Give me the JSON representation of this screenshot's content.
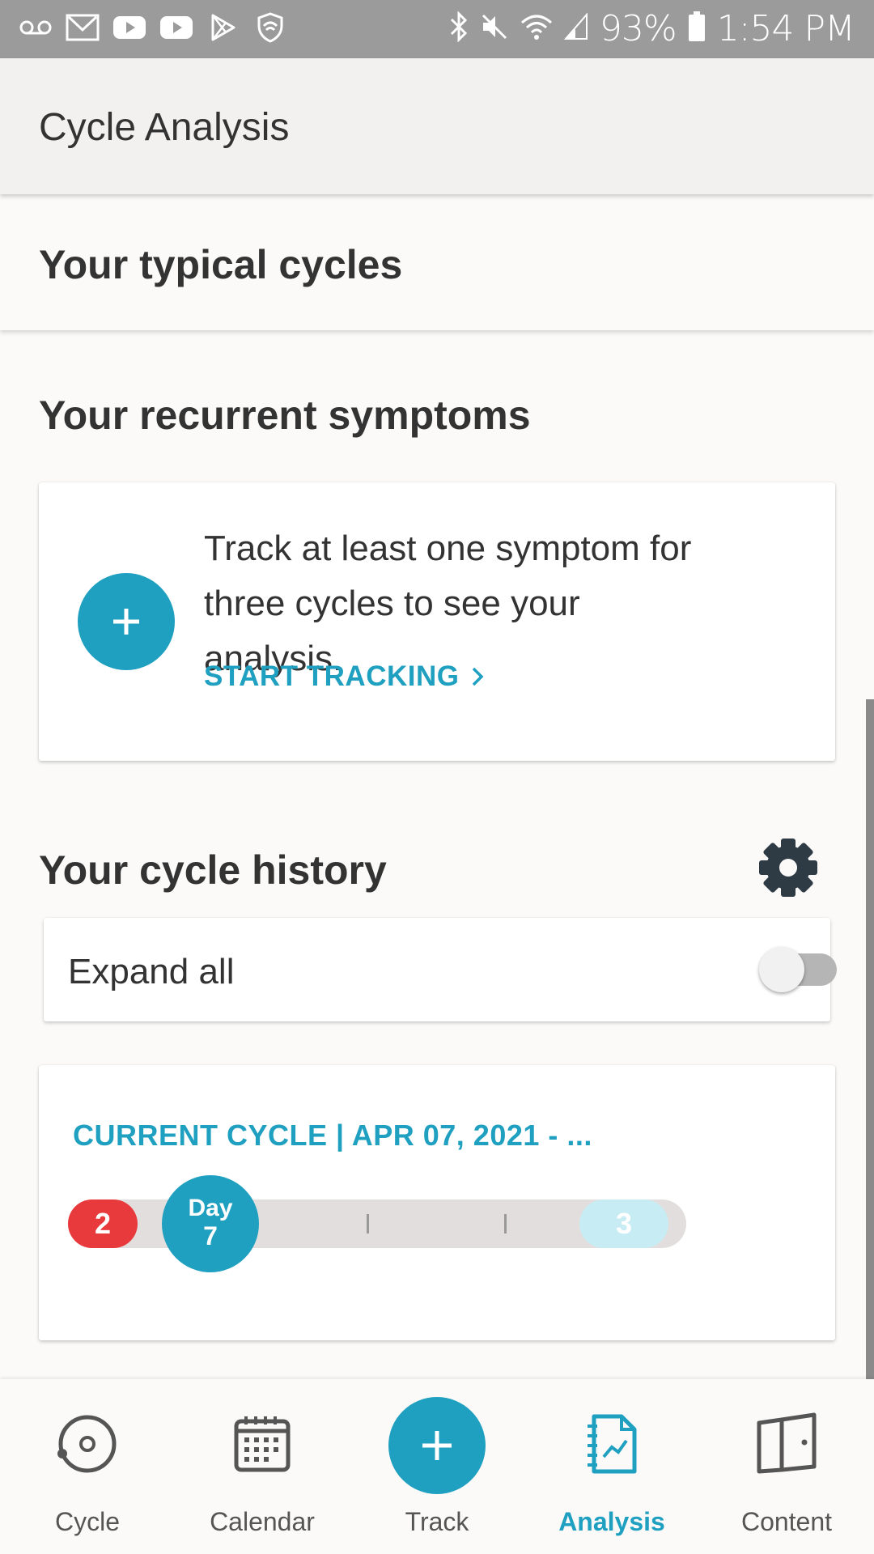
{
  "status_bar": {
    "battery": "93%",
    "time": "1:54 PM",
    "icons": [
      "voicemail-icon",
      "gmail-icon",
      "youtube-icon",
      "youtube-icon",
      "play-store-icon",
      "shield-icon",
      "bluetooth-icon",
      "mute-icon",
      "wifi-icon",
      "signal-icon",
      "battery-icon"
    ]
  },
  "app_bar": {
    "title": "Cycle Analysis"
  },
  "typical": {
    "title": "Your typical cycles"
  },
  "symptoms": {
    "title": "Your recurrent symptoms",
    "message": "Track at least one symptom for three cycles to see your analysis.",
    "link": "START TRACKING"
  },
  "history": {
    "title": "Your cycle history",
    "expand_label": "Expand all",
    "expand_on": false,
    "current_cycle": {
      "header": "CURRENT CYCLE | APR 07, 2021 - ...",
      "period_days": "2",
      "day_label": "Day",
      "day_number": "7",
      "fertile_label": "3"
    }
  },
  "bottom_nav": {
    "items": [
      {
        "label": "Cycle",
        "icon": "cycle-icon"
      },
      {
        "label": "Calendar",
        "icon": "calendar-icon"
      },
      {
        "label": "Track",
        "icon": "plus-icon"
      },
      {
        "label": "Analysis",
        "icon": "analysis-icon",
        "active": true
      },
      {
        "label": "Content",
        "icon": "book-icon"
      }
    ]
  },
  "colors": {
    "accent": "#1fa0c0",
    "period": "#e8393d",
    "fertile": "#c8ecf3",
    "status_bar": "#9b9b9b"
  }
}
